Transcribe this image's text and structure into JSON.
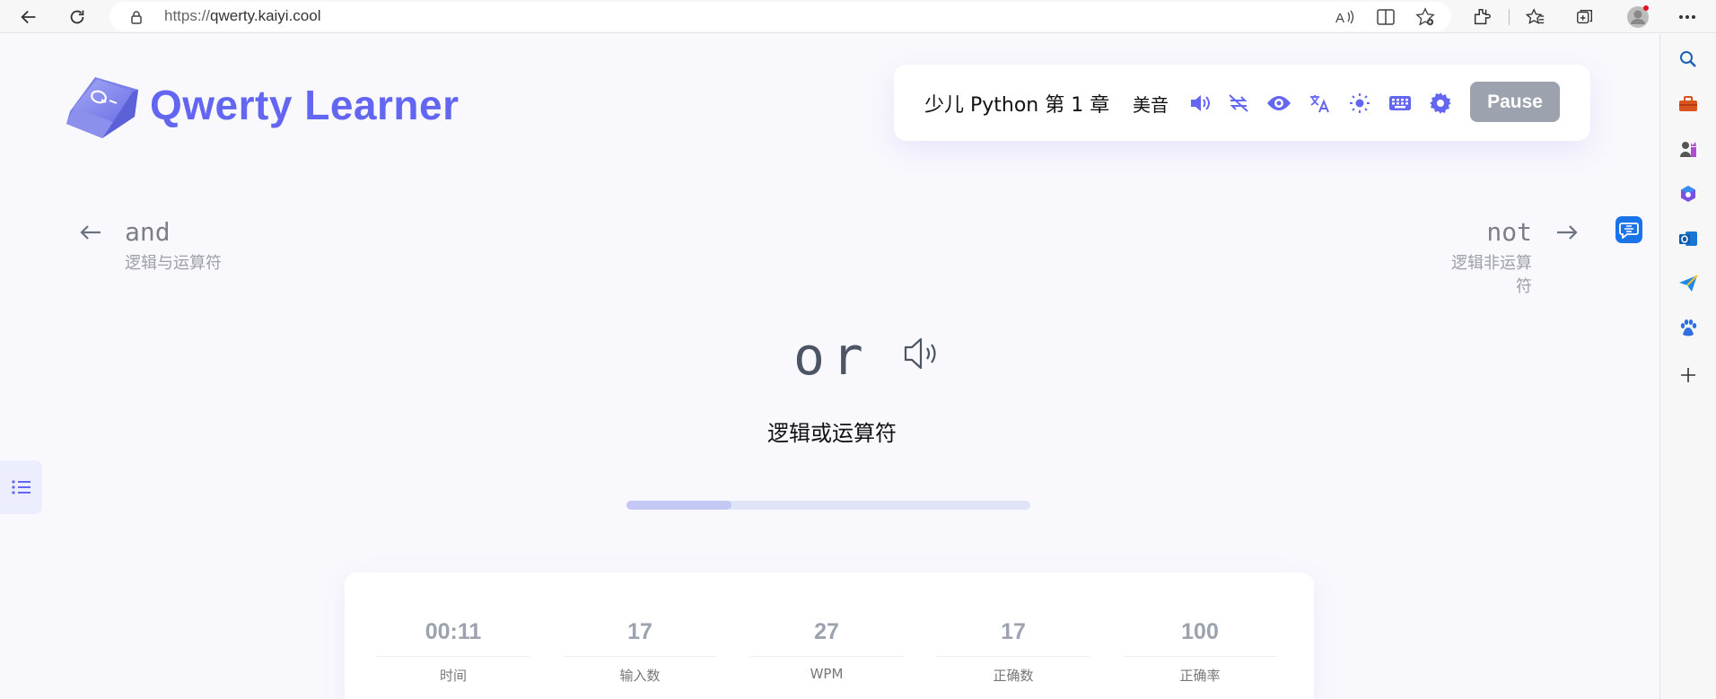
{
  "browser": {
    "url_prefix": "https://",
    "url_host": "qwerty.kaiyi.cool"
  },
  "brand": {
    "name": "Qwerty Learner"
  },
  "toolbar": {
    "chapter": "少儿 Python 第 1 章",
    "accent": "美音",
    "pause_label": "Pause"
  },
  "prev_word": {
    "word": "and",
    "translation": "逻辑与运算符"
  },
  "next_word": {
    "word": "not",
    "translation": "逻辑非运算符"
  },
  "current": {
    "word": "or",
    "translation": "逻辑或运算符",
    "progress": 0.26
  },
  "stats": [
    {
      "value": "00:11",
      "label": "时间"
    },
    {
      "value": "17",
      "label": "输入数"
    },
    {
      "value": "27",
      "label": "WPM"
    },
    {
      "value": "17",
      "label": "正确数"
    },
    {
      "value": "100",
      "label": "正确率"
    }
  ],
  "colors": {
    "accent": "#6366f1",
    "pause_bg": "#9ca3af"
  }
}
